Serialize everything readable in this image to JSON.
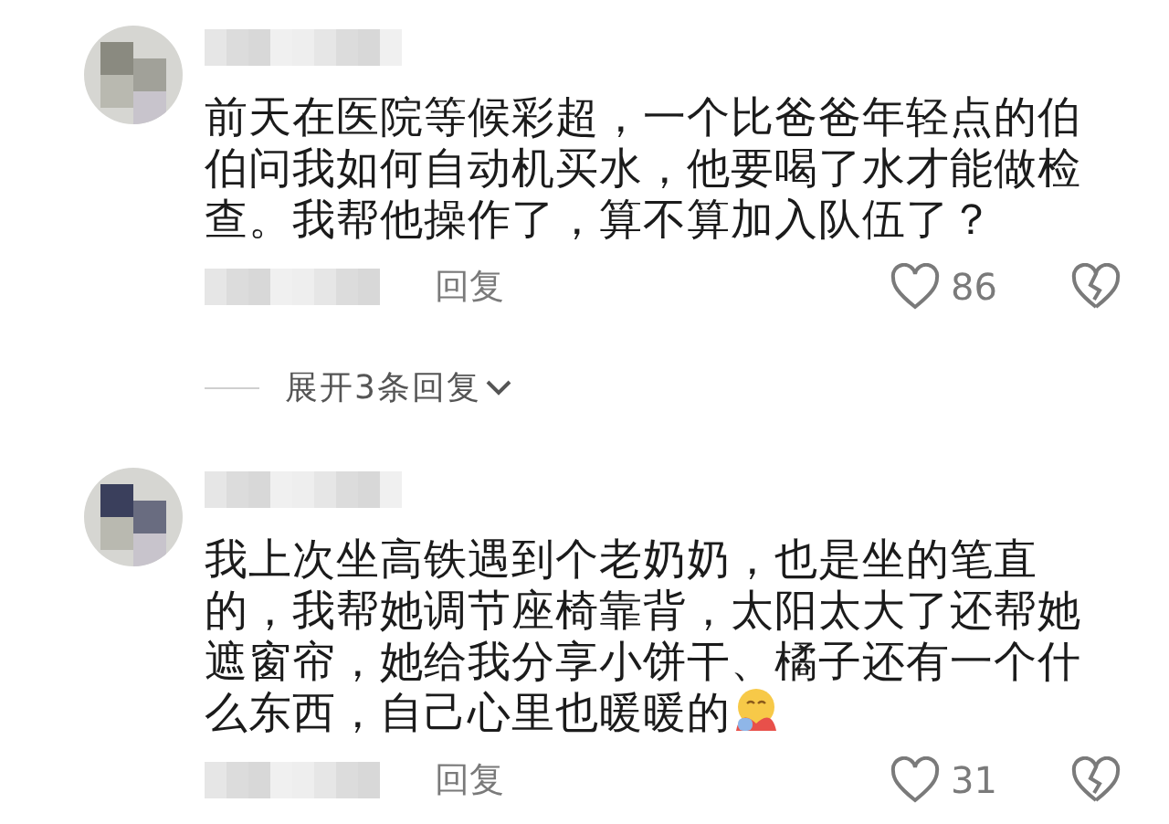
{
  "comments": [
    {
      "text": "前天在医院等候彩超，一个比爸爸年轻点的伯伯问我如何自动机买水，他要喝了水才能做检查。我帮他操作了，算不算加入队伍了？",
      "emoji": false,
      "reply_label": "回复",
      "likes": "86",
      "expand": "展开3条回复"
    },
    {
      "text": "我上次坐高铁遇到个老奶奶，也是坐的笔直的，我帮她调节座椅靠背，太阳太大了还帮她遮窗帘，她给我分享小饼干、橘子还有一个什么东西，自己心里也暖暖的",
      "emoji": true,
      "reply_label": "回复",
      "likes": "31"
    }
  ]
}
